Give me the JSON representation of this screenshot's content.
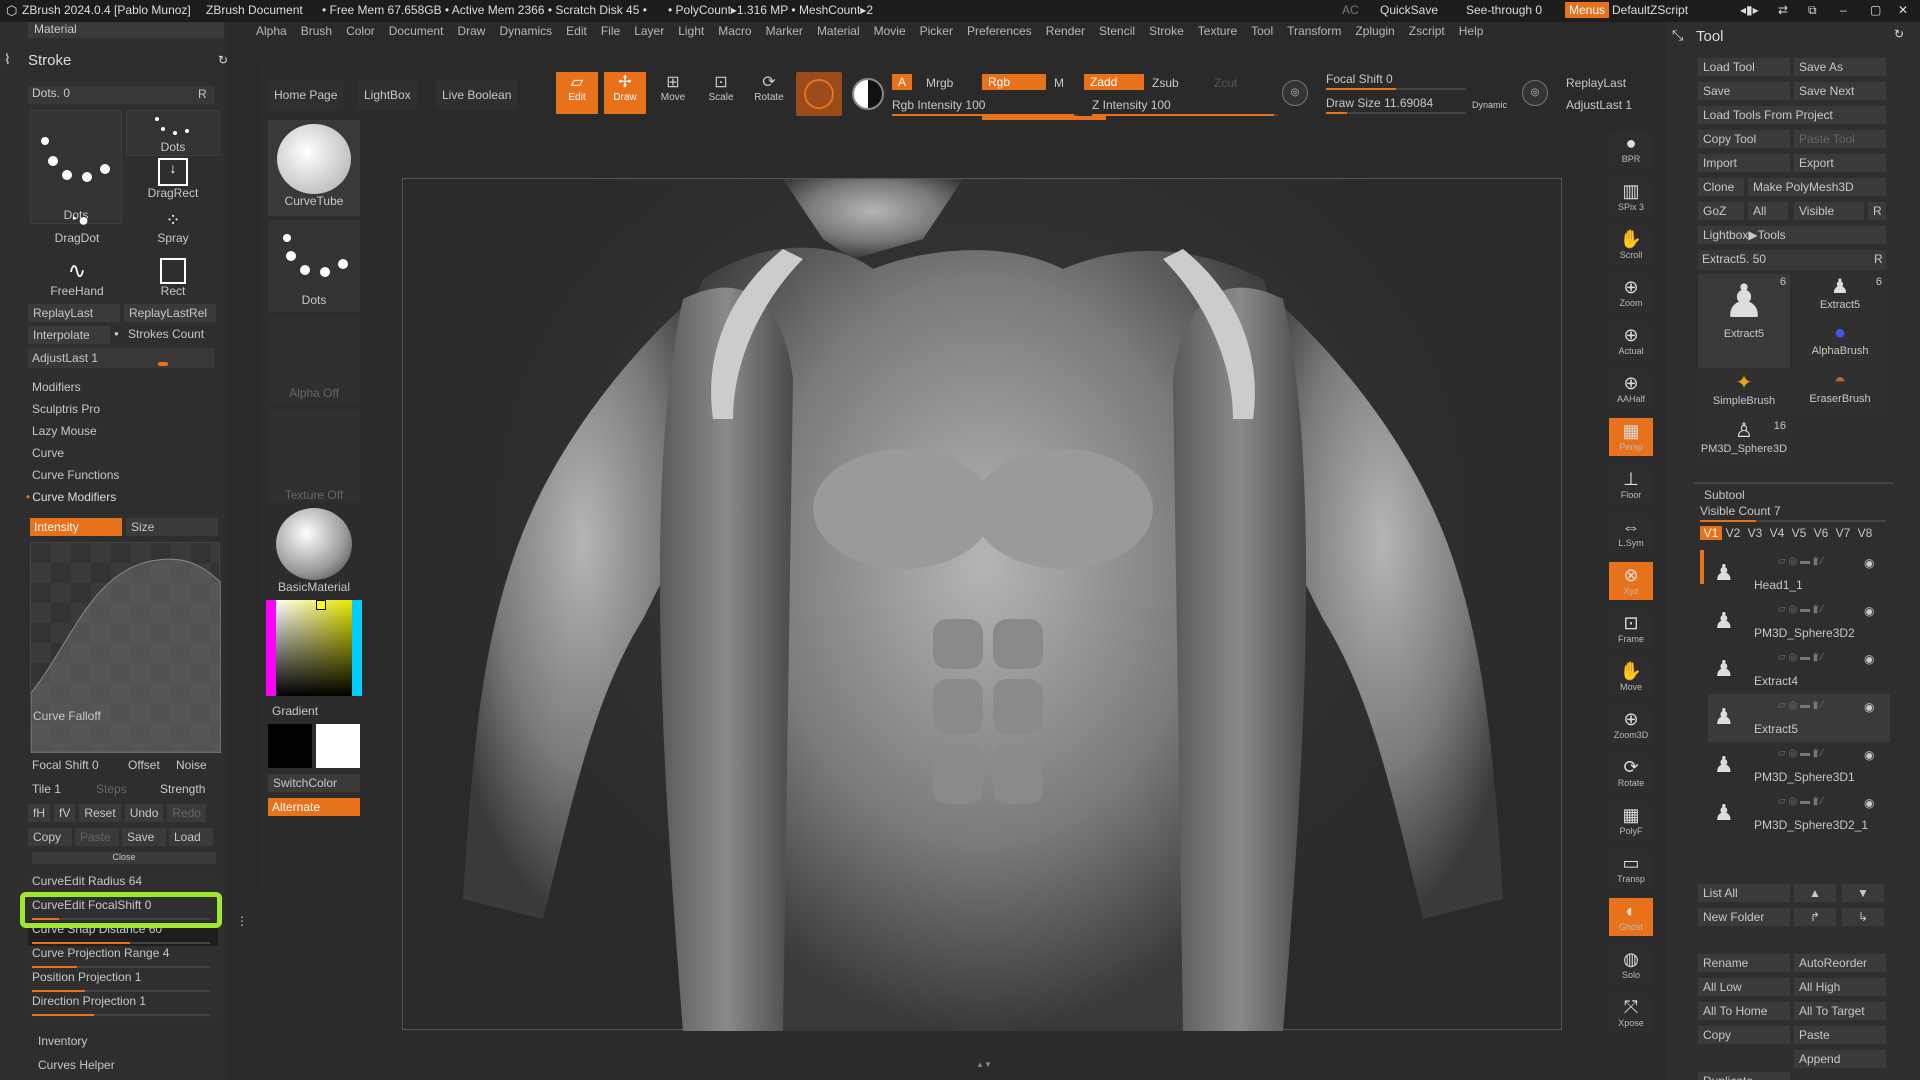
{
  "title": {
    "app": "ZBrush 2024.0.4 [Pablo Munoz]",
    "doc": "ZBrush Document",
    "mem": "• Free Mem 67.658GB • Active Mem 2366 • Scratch Disk 45 •",
    "poly": "• PolyCount▸1.316 MP • MeshCount▸2",
    "ac": "AC",
    "quicksave": "QuickSave",
    "seethrough": "See-through",
    "seethrough_val": "0",
    "menus": "Menus",
    "script": "DefaultZScript"
  },
  "menus": [
    "Alpha",
    "Brush",
    "Color",
    "Document",
    "Draw",
    "Dynamics",
    "Edit",
    "File",
    "Layer",
    "Light",
    "Macro",
    "Marker",
    "Material",
    "Movie",
    "Picker",
    "Preferences",
    "Render",
    "Stencil",
    "Stroke",
    "Texture",
    "Tool",
    "Transform",
    "Zplugin",
    "Zscript",
    "Help"
  ],
  "left": {
    "material_tab": "Material",
    "header": "Stroke",
    "dots": "Dots",
    "dots_val": "0",
    "r": "R",
    "strokes": [
      "Dots",
      "Dots",
      "DragRect",
      "DragDot",
      "Spray",
      "FreeHand",
      "Rect"
    ],
    "replaylast": "ReplayLast",
    "replaylastrel": "ReplayLastRel",
    "interpolate": "Interpolate",
    "strokescount": "Strokes Count",
    "adjustlast": "AdjustLast",
    "adjustlast_val": "1",
    "sections": [
      "Modifiers",
      "Sculptris Pro",
      "Lazy Mouse",
      "Curve",
      "Curve Functions",
      "Curve Modifiers"
    ],
    "intensity": "Intensity",
    "size": "Size",
    "curvefalloff": "Curve Falloff",
    "focalshift": "Focal Shift",
    "focalshift_val": "0",
    "offset": "Offset",
    "noise": "Noise",
    "tile": "Tile",
    "tile_val": "1",
    "steps": "Steps",
    "strength": "Strength",
    "btns": [
      "fH",
      "fV",
      "Reset",
      "Undo",
      "Redo"
    ],
    "btns2": [
      "Copy",
      "Paste",
      "Save",
      "Load"
    ],
    "close": "Close",
    "params": [
      {
        "label": "CurveEdit Radius",
        "val": "64"
      },
      {
        "label": "CurveEdit FocalShift",
        "val": "0"
      },
      {
        "label": "Curve Snap Distance",
        "val": "60"
      },
      {
        "label": "Curve Projection Range",
        "val": "4"
      },
      {
        "label": "Position Projection",
        "val": "1"
      },
      {
        "label": "Direction Projection",
        "val": "1"
      }
    ],
    "inventory": "Inventory",
    "curveshelper": "Curves Helper"
  },
  "shelf": {
    "curvetube": "CurveTube",
    "dots": "Dots",
    "alphaoff": "Alpha Off",
    "textureoff": "Texture Off",
    "material": "BasicMaterial",
    "gradient": "Gradient",
    "switchcolor": "SwitchColor",
    "alternate": "Alternate"
  },
  "toolbar": {
    "homepage": "Home Page",
    "lightbox": "LightBox",
    "liveboolean": "Live Boolean",
    "edit": "Edit",
    "draw": "Draw",
    "move": "Move",
    "scale": "Scale",
    "rotate": "Rotate",
    "a": "A",
    "mrgb": "Mrgb",
    "rgb": "Rgb",
    "m": "M",
    "zadd": "Zadd",
    "zsub": "Zsub",
    "zcut": "Zcut",
    "rgbintensity": "Rgb Intensity",
    "rgbintensity_val": "100",
    "zintensity": "Z Intensity",
    "zintensity_val": "100",
    "focalshift": "Focal Shift",
    "focalshift_val": "0",
    "drawsize": "Draw Size",
    "drawsize_val": "11.69084",
    "dynamic": "Dynamic",
    "replaylast": "ReplayLast",
    "adjustlast": "AdjustLast",
    "adjustlast_val": "1"
  },
  "rightstrip": [
    "BPR",
    "SPix 3",
    "Scroll",
    "Zoom",
    "Actual",
    "AAHalf",
    "Persp",
    "Floor",
    "L.Sym",
    "Xyz",
    "Frame",
    "Move",
    "Zoom3D",
    "Rotate",
    "PolyF",
    "Transp",
    "Ghost",
    "Solo",
    "Xpose"
  ],
  "tool": {
    "header": "Tool",
    "loadtool": "Load Tool",
    "saveas": "Save As",
    "save": "Save",
    "savenext": "Save Next",
    "loadfromproject": "Load Tools From Project",
    "copytool": "Copy Tool",
    "pastetool": "Paste Tool",
    "import": "Import",
    "export": "Export",
    "clone": "Clone",
    "makepolymesh": "Make PolyMesh3D",
    "goz": "GoZ",
    "all": "All",
    "visible": "Visible",
    "r": "R",
    "lightboxtools": "Lightbox▶Tools",
    "current": "Extract5.",
    "current_val": "50",
    "thumbs": [
      {
        "name": "Extract5",
        "count": "6"
      },
      {
        "name": "Extract5",
        "count": "6"
      },
      {
        "name": "AlphaBrush",
        "count": ""
      },
      {
        "name": "SimpleBrush",
        "count": ""
      },
      {
        "name": "EraserBrush",
        "count": ""
      },
      {
        "name": "PM3D_Sphere3D",
        "count": "16"
      }
    ],
    "subtool": "Subtool",
    "visiblecount": "Visible Count",
    "visiblecount_val": "7",
    "vtabs": [
      "V1",
      "V2",
      "V3",
      "V4",
      "V5",
      "V6",
      "V7",
      "V8"
    ],
    "subtools": [
      "Head1_1",
      "PM3D_Sphere3D2",
      "Extract4",
      "Extract5",
      "PM3D_Sphere3D1",
      "PM3D_Sphere3D2_1"
    ],
    "listall": "List All",
    "newfolder": "New Folder",
    "rename": "Rename",
    "autoreorder": "AutoReorder",
    "alllow": "All Low",
    "allhigh": "All High",
    "alltohome": "All To Home",
    "alltotarget": "All To Target",
    "copy": "Copy",
    "paste": "Paste",
    "append": "Append",
    "duplicate": "Duplicate"
  }
}
